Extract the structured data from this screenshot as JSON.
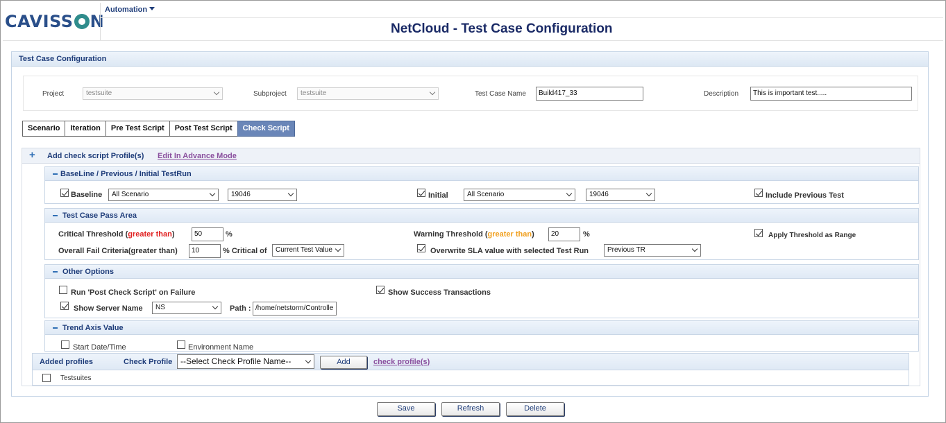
{
  "brand": {
    "logo_pre": "CAVISS",
    "logo_post": "N"
  },
  "menu": {
    "label": "Automation"
  },
  "page_title": "NetCloud - Test Case Configuration",
  "panel": {
    "title": "Test Case Configuration",
    "project_label": "Project",
    "project_value": "testsuite",
    "subproject_label": "Subproject",
    "subproject_value": "testsuite",
    "testcase_label": "Test Case Name",
    "testcase_value": "Build417_33",
    "description_label": "Description",
    "description_value": "This is important test....."
  },
  "tabs": [
    {
      "label": "Scenario",
      "active": false
    },
    {
      "label": "Iteration",
      "active": false
    },
    {
      "label": "Pre Test Script",
      "active": false
    },
    {
      "label": "Post Test Script",
      "active": false
    },
    {
      "label": "Check Script",
      "active": true
    }
  ],
  "check_script": {
    "add_label": "Add check script Profile(s)",
    "advance_link": "Edit In Advance Mode",
    "baseline_section": {
      "title": "BaseLine / Previous / Initial TestRun",
      "baseline_label": "Baseline",
      "baseline_checked": true,
      "baseline_scenario": "All Scenario",
      "baseline_run": "19046",
      "initial_label": "Initial",
      "initial_checked": true,
      "initial_scenario": "All Scenario",
      "initial_run": "19046",
      "include_prev_label": "Include Previous Test",
      "include_prev_checked": true
    },
    "pass_section": {
      "title": "Test Case Pass Area",
      "critical_label": "Critical Threshold (",
      "critical_qual": "greater than",
      "critical_close": ")",
      "critical_value": "50",
      "pct": "%",
      "warning_label": "Warning Threshold (",
      "warning_qual": "greater than",
      "warning_close": ")",
      "warning_value": "20",
      "range_label": "Apply Threshold as Range",
      "range_checked": true,
      "overall_label": "Overall Fail Criteria(greater than)",
      "overall_value": "10",
      "critical_of_label": "% Critical of",
      "critical_of_value": "Current Test Value",
      "overwrite_label": "Overwrite SLA value with selected Test Run",
      "overwrite_checked": true,
      "overwrite_value": "Previous TR"
    },
    "other_section": {
      "title": "Other Options",
      "post_check_label": "Run 'Post Check Script' on Failure",
      "post_check_checked": false,
      "success_label": "Show Success Transactions",
      "success_checked": true,
      "server_label": "Show Server Name",
      "server_checked": true,
      "server_value": "NS",
      "path_label": "Path :",
      "path_value": "/home/netstorm/Controlle"
    },
    "trend_section": {
      "title": "Trend Axis Value",
      "start_label": "Start Date/Time",
      "start_checked": false,
      "env_label": "Environment Name",
      "env_checked": false
    },
    "added_profiles": {
      "title": "Added profiles",
      "check_profile_label": "Check Profile",
      "select_value": "--Select Check Profile Name--",
      "add_button": "Add",
      "link": "check profile(s)",
      "rows": [
        {
          "name": "Testsuites",
          "checked": false
        }
      ]
    }
  },
  "footer": {
    "save": "Save",
    "refresh": "Refresh",
    "delete": "Delete"
  }
}
